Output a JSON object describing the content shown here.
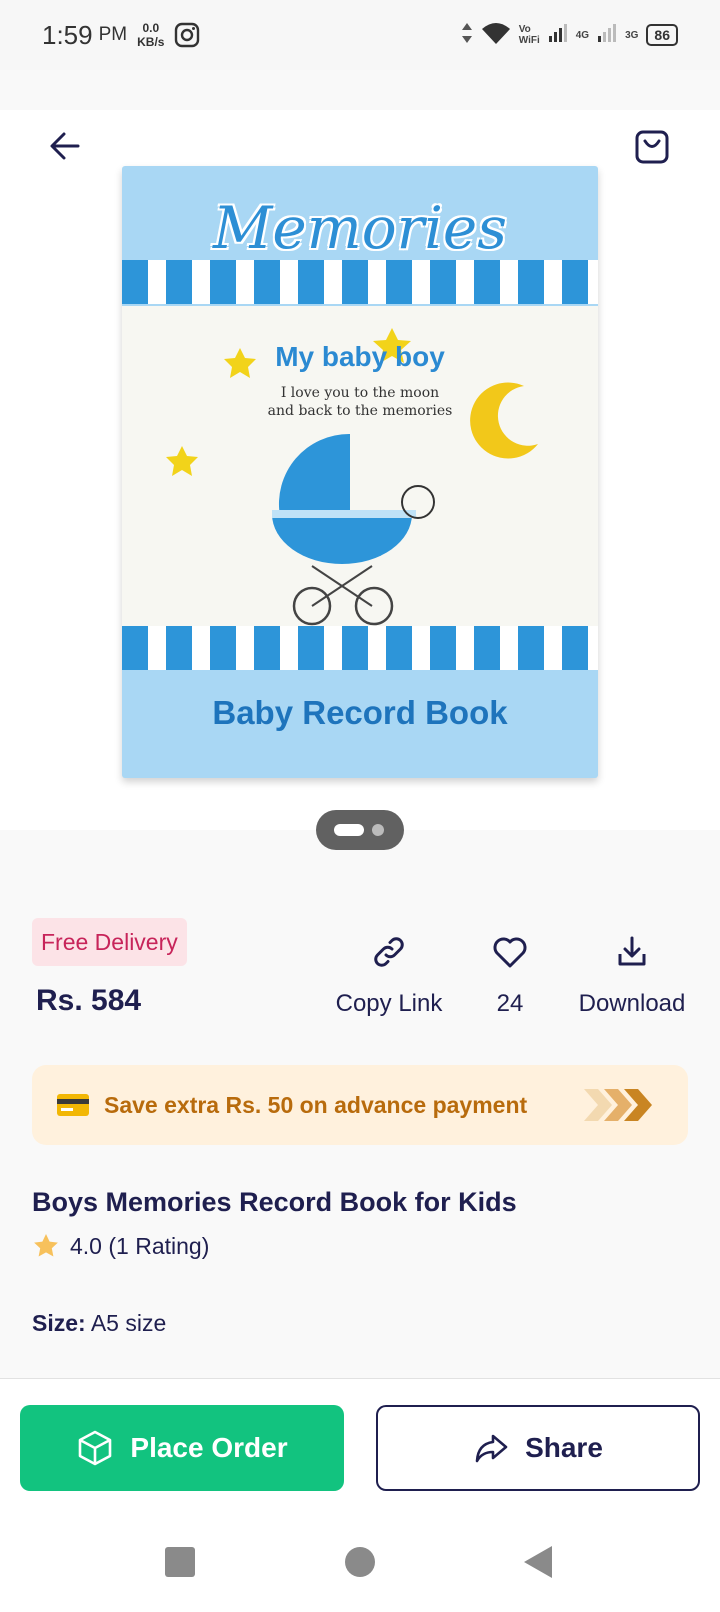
{
  "status_bar": {
    "time": "1:59",
    "ampm": "PM",
    "speed_value": "0.0",
    "speed_unit": "KB/s",
    "volte": "Vo",
    "wifi": "WiFi",
    "net1": "4G",
    "net2": "3G",
    "battery": "86"
  },
  "product_image": {
    "title": "Memories",
    "subtitle": "My baby boy",
    "tagline_1": "I love you to the moon",
    "tagline_2": "and back to the memories",
    "bottom": "Baby Record Book",
    "page_current": 1,
    "page_total": 2
  },
  "delivery_badge": "Free Delivery",
  "price": "Rs. 584",
  "actions": {
    "copy_link": "Copy Link",
    "likes": "24",
    "download": "Download"
  },
  "offer": {
    "text": "Save extra Rs. 50 on advance payment"
  },
  "product": {
    "title": "Boys Memories Record Book for Kids",
    "rating": "4.0 (1 Rating)",
    "size_label": "Size:",
    "size_value": "A5 size"
  },
  "buttons": {
    "place_order": "Place Order",
    "share": "Share"
  },
  "colors": {
    "accent_green": "#12c37f",
    "navy": "#1f1f4f",
    "badge_pink": "#c7245a",
    "offer_orange": "#b86b0c"
  }
}
